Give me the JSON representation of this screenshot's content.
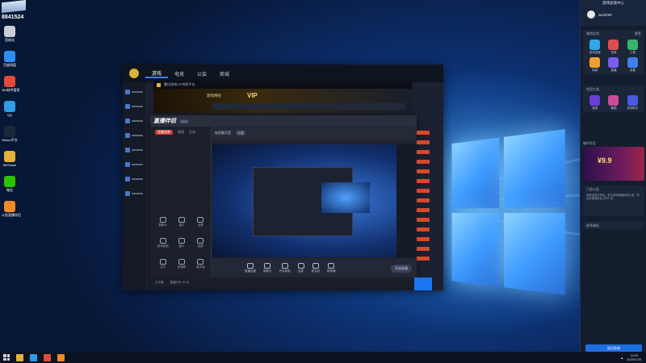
{
  "desktop": {
    "badge_number": "8841524",
    "icons": [
      {
        "label": "回收站",
        "icon": "recycle-bin-icon",
        "color": "#c7ced8"
      },
      {
        "label": "百度网盘",
        "icon": "cloud-icon",
        "color": "#2f8ff0"
      },
      {
        "label": "360软件管家",
        "icon": "software-manager-icon",
        "color": "#e24a3b"
      },
      {
        "label": "QQ",
        "icon": "qq-icon",
        "color": "#2d9be6"
      },
      {
        "label": "Steam平台",
        "icon": "steam-icon",
        "color": "#1b2838"
      },
      {
        "label": "WeGame",
        "icon": "wegame-icon",
        "color": "#e0b43a"
      },
      {
        "label": "微信",
        "icon": "wechat-icon",
        "color": "#2dc100"
      },
      {
        "label": "斗鱼直播伴侣",
        "icon": "douyu-icon",
        "color": "#f08a24"
      }
    ]
  },
  "app_window": {
    "tabs": [
      "游戏",
      "电竞",
      "公会",
      "商城"
    ],
    "active_tab": 0
  },
  "overlay": {
    "title": "腾讯游戏VIP特权平台",
    "banner_label": "游戏特权",
    "vip_text": "VIP"
  },
  "broadcast": {
    "brand": "直播伴侣",
    "version": "V6.2",
    "left_tabs": [
      "直播场景",
      "视频",
      "互动"
    ],
    "tools": [
      {
        "label": "摄像头"
      },
      {
        "label": "窗口"
      },
      {
        "label": "全屏"
      },
      {
        "label": "游戏画面"
      },
      {
        "label": "图片"
      },
      {
        "label": "投屏"
      },
      {
        "label": "文字"
      },
      {
        "label": "多媒体"
      },
      {
        "label": "画中画"
      }
    ],
    "sub_title": "电竞聊天室",
    "sub_chip": "分类",
    "toolbar": [
      {
        "label": "直播设置"
      },
      {
        "label": "摄像头"
      },
      {
        "label": "开始录制"
      },
      {
        "label": "连麦"
      },
      {
        "label": "麦克风"
      },
      {
        "label": "扬声器"
      }
    ],
    "start_live": "开始直播",
    "status_left": "已开播",
    "status_mid": "直播时长 00:00"
  },
  "right_panel": {
    "title": "游戏加速中心",
    "user": "wei3050",
    "sections": [
      {
        "title": "我的应用",
        "more": "更多",
        "apps": [
          {
            "label": "游戏加速",
            "color": "#2ea8e8"
          },
          {
            "label": "电竞",
            "color": "#e04c4c"
          },
          {
            "label": "工具",
            "color": "#3ab26a"
          },
          {
            "label": "商城",
            "color": "#f0a030"
          },
          {
            "label": "直播",
            "color": "#7a5cf0"
          },
          {
            "label": "设置",
            "color": "#3f7ff0"
          }
        ]
      },
      {
        "title": "实用工具",
        "more": "",
        "apps": [
          {
            "label": "录屏",
            "color": "#6a3fd8"
          },
          {
            "label": "截图",
            "color": "#d04a9a"
          },
          {
            "label": "游戏助手",
            "color": "#4a5be0"
          }
        ]
      }
    ],
    "promo_heading": "福利专区",
    "promo_price": "¥9.9",
    "notice_heading": "门店公告",
    "notice_text": "本周活动已开启，参与游戏赢取精彩礼品，详情请咨询前台工作人员。",
    "bar_label": "更多精彩",
    "button_label": "退出系统"
  },
  "taskbar": {
    "time": "11:00",
    "date": "2023/1/29"
  }
}
